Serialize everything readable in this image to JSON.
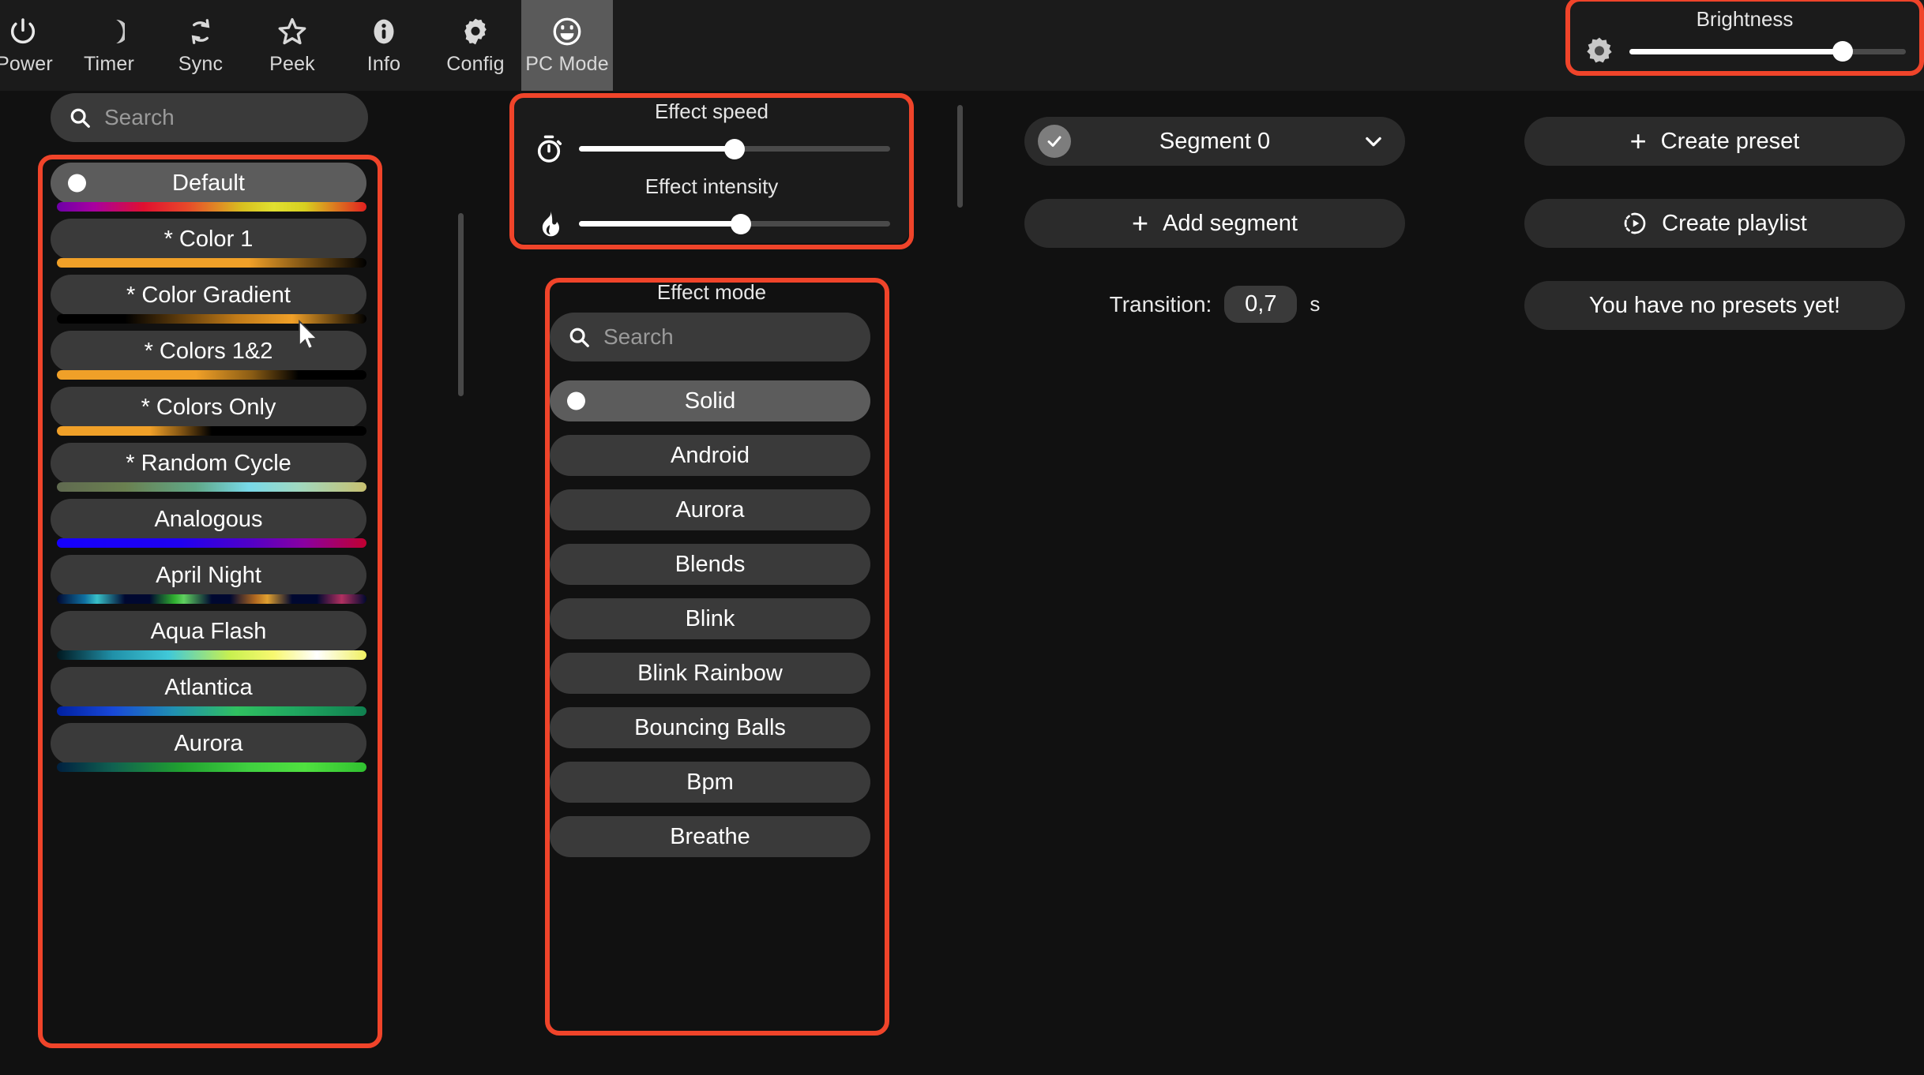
{
  "tabbar": {
    "tabs": [
      {
        "label": "Power",
        "icon": "power-icon",
        "active": false
      },
      {
        "label": "Timer",
        "icon": "moon-icon",
        "active": false
      },
      {
        "label": "Sync",
        "icon": "sync-icon",
        "active": false
      },
      {
        "label": "Peek",
        "icon": "star-icon",
        "active": false
      },
      {
        "label": "Info",
        "icon": "info-icon",
        "active": false
      },
      {
        "label": "Config",
        "icon": "gear-icon",
        "active": false
      },
      {
        "label": "PC Mode",
        "icon": "smiley-icon",
        "active": true
      }
    ]
  },
  "brightness": {
    "label": "Brightness",
    "icon": "brightness-sun-icon",
    "value_pct": 77
  },
  "palette_panel": {
    "search": {
      "placeholder": "Search",
      "value": "",
      "icon": "search-icon"
    },
    "items": [
      {
        "name": "Default",
        "selected": true,
        "gradient": "linear-gradient(90deg,#6d00a8 0%,#a800a0 12%,#e01030 28%,#e8482a 42%,#d8c020 60%,#e0e030 70%,#d8d020 80%,#e02020 100%)"
      },
      {
        "name": "* Color 1",
        "selected": false,
        "gradient": "linear-gradient(90deg,#f0a028 0%,#f0a028 62%,#000000 100%)"
      },
      {
        "name": "* Color Gradient",
        "selected": false,
        "gradient": "linear-gradient(90deg,#000000 0%,#000000 22%,#c07a18 58%,#f0a028 76%,#000000 100%)"
      },
      {
        "name": "* Colors 1&2",
        "selected": false,
        "gradient": "linear-gradient(90deg,#f0a028 0%,#f0a028 45%,#8a5c14 63%,#000000 78%,#000000 100%)"
      },
      {
        "name": "* Colors Only",
        "selected": false,
        "gradient": "linear-gradient(90deg,#f0a028 0%,#f0a028 30%,#845614 40%,#000000 50%,#000000 100%)"
      },
      {
        "name": "* Random Cycle",
        "selected": false,
        "gradient": "linear-gradient(90deg,#606a50 0%,#6a8050 22%,#60a888 45%,#78d8e8 62%,#a0d8c0 78%,#c8c070 100%)"
      },
      {
        "name": "Analogous",
        "selected": false,
        "gradient": "linear-gradient(90deg,#1500ff 0%,#2000f0 40%,#5000c8 62%,#8a00a0 80%,#c00030 100%)"
      },
      {
        "name": "April Night",
        "selected": false,
        "gradient": "linear-gradient(90deg,#000830 0%,#1070a0 9%,#38c0c8 13%,#000830 22%,#000830 30%,#30b030 38%,#60d060 41%,#000830 50%,#000830 56%,#b06820 64%,#e0a030 68%,#000830 76%,#000830 84%,#b03060 92%,#000830 100%)"
      },
      {
        "name": "Aqua Flash",
        "selected": false,
        "gradient": "linear-gradient(90deg,#001820 0%,#2090a8 18%,#40c8d8 36%,#c8f050 56%,#f8f870 70%,#ffffff 84%,#f0f060 100%)"
      },
      {
        "name": "Atlantica",
        "selected": false,
        "gradient": "linear-gradient(90deg,#0020a0 0%,#1848d8 18%,#2090b0 38%,#30c060 58%,#20a860 76%,#108050 100%)"
      },
      {
        "name": "Aurora",
        "selected": false,
        "gradient": "linear-gradient(90deg,#002040 0%,#106050 18%,#20a030 40%,#40d040 62%,#50e040 80%,#30c030 100%)"
      }
    ]
  },
  "effect_controls": {
    "speed": {
      "label": "Effect speed",
      "icon": "stopwatch-icon",
      "value_pct": 50
    },
    "intensity": {
      "label": "Effect intensity",
      "icon": "flame-icon",
      "value_pct": 52
    }
  },
  "effect_panel": {
    "title": "Effect mode",
    "search": {
      "placeholder": "Search",
      "value": "",
      "icon": "search-icon"
    },
    "items": [
      {
        "name": "Solid",
        "selected": true
      },
      {
        "name": "Android",
        "selected": false
      },
      {
        "name": "Aurora",
        "selected": false
      },
      {
        "name": "Blends",
        "selected": false
      },
      {
        "name": "Blink",
        "selected": false
      },
      {
        "name": "Blink Rainbow",
        "selected": false
      },
      {
        "name": "Bouncing Balls",
        "selected": false
      },
      {
        "name": "Bpm",
        "selected": false
      },
      {
        "name": "Breathe",
        "selected": false
      }
    ]
  },
  "segments": {
    "current": {
      "label": "Segment 0",
      "checked": true,
      "check_icon": "check-icon",
      "chevron_icon": "chevron-down-icon"
    },
    "add": {
      "label": "Add segment",
      "icon": "plus-icon"
    },
    "transition": {
      "label": "Transition:",
      "value": "0,7",
      "unit": "s"
    }
  },
  "presets": {
    "create_preset": {
      "label": "Create preset",
      "icon": "plus-icon"
    },
    "create_playlist": {
      "label": "Create playlist",
      "icon": "playlist-play-icon"
    },
    "empty_message": "You have no presets yet!"
  },
  "colors": {
    "background": "#111111",
    "panel": "#1b1b1b",
    "control": "#3a3a3a",
    "control_selected": "#5c5c5c",
    "button": "#2b2b2b",
    "highlight_outline": "#f0442a",
    "text": "#ffffff",
    "text_muted": "#9a9a9a"
  }
}
